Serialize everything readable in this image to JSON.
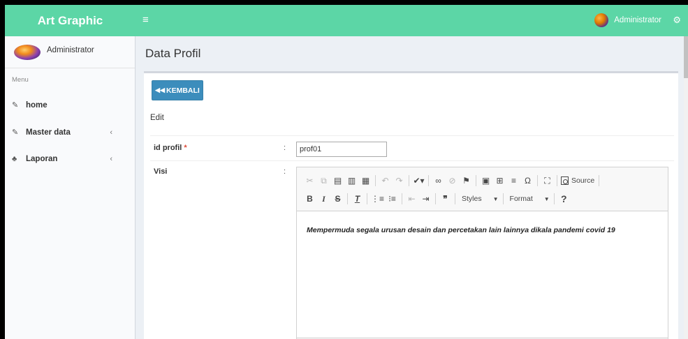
{
  "header": {
    "brand": "Art Graphic",
    "menu_icon": "hamburger-icon",
    "user_name": "Administrator",
    "settings_icon": "gears-icon",
    "color": "#5cd6a6"
  },
  "sidebar": {
    "user_name": "Administrator",
    "menu_header": "Menu",
    "items": [
      {
        "label": "home",
        "icon": "edit-icon",
        "has_children": false
      },
      {
        "label": "Master data",
        "icon": "edit-icon",
        "has_children": true
      },
      {
        "label": "Laporan",
        "icon": "sitemap-icon",
        "has_children": true
      }
    ]
  },
  "main": {
    "page_title": "Data Profil",
    "back_button": "KEMBALI",
    "section_label": "Edit",
    "fields": {
      "id_profil_label": "id profil",
      "required_mark": "*",
      "id_profil_value": "prof01",
      "visi_label": "Visi",
      "colon": ":"
    },
    "editor": {
      "source_label": "Source",
      "styles_label": "Styles",
      "format_label": "Format",
      "content": "Mempermuda segala urusan desain dan percetakan lain lainnya dikala pandemi covid 19"
    },
    "accent_color": "#3c8dbc"
  }
}
